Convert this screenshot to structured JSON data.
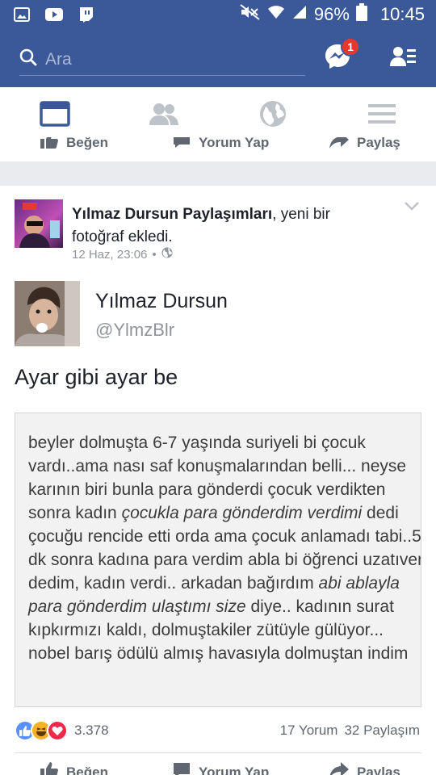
{
  "status_bar": {
    "battery": "96%",
    "time": "10:45",
    "icons": [
      "gallery-icon",
      "youtube-icon",
      "twitch-icon",
      "mute-icon",
      "wifi-icon",
      "signal-icon",
      "battery-icon"
    ]
  },
  "search": {
    "placeholder": "Ara",
    "messenger_badge": "1"
  },
  "tabs": [
    "news-feed-icon",
    "friends-icon",
    "globe-icon",
    "menu-icon"
  ],
  "previous_post_actions": {
    "like": "Beğen",
    "comment": "Yorum Yap",
    "share": "Paylaş"
  },
  "post": {
    "page_name": "Yılmaz Dursun Paylaşımları",
    "action_text": ", yeni bir fotoğraf ekledi.",
    "date": "12 Haz, 23:06",
    "separator": "•",
    "audience_icon": "globe-icon",
    "quote": {
      "name": "Yılmaz Dursun",
      "handle": "@YlmzBlr",
      "text": "Ayar gibi ayar be"
    },
    "image_text": {
      "p1": "beyler dolmuşta 6-7 yaşında suriyeli bi çocuk vardı..ama nası saf konuşmalarından belli... neyse karının biri bunla para gönderdi çocuk verdikten sonra kadın ",
      "i1": "çocukla para gönderdim verdimi",
      "p2": " dedi çocuğu rencide etti orda ama çocuk anlamadı tabi..5 dk sonra kadına para verdim abla bi öğrenci uzatıver dedim, kadın verdi.. arkadan bağırdım ",
      "i2": "abi ablayla para gönderdim ulaştımı size",
      "p3": " diye.. kadının surat kıpkırmızı kaldı, dolmuştakiler zütüyle gülüyor... nobel barış ödülü almış havasıyla dolmuştan indim"
    },
    "reactions_count": "3.378",
    "comments": "17 Yorum",
    "shares": "32 Paylaşım",
    "actions": {
      "like": "Beğen",
      "comment": "Yorum Yap",
      "share": "Paylaş"
    }
  },
  "colors": {
    "brand": "#3b5998",
    "badge": "#e8372c",
    "like": "#5890ff",
    "haha": "#f7b125",
    "love": "#f0284a"
  }
}
